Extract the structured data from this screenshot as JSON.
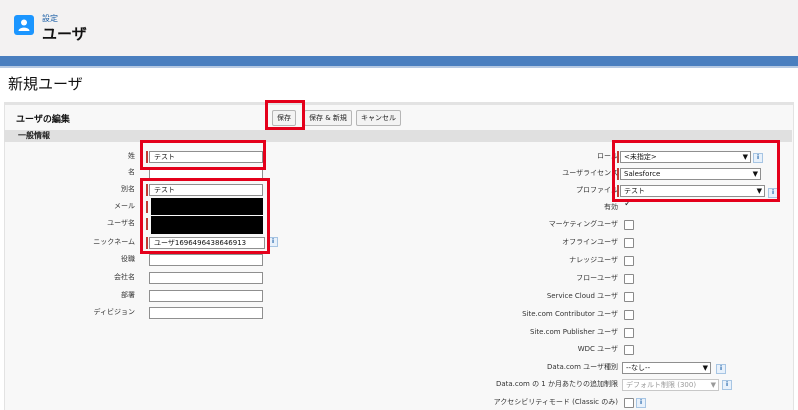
{
  "header": {
    "subtitle": "設定",
    "title": "ユーザ",
    "icon": "user-icon"
  },
  "page": {
    "title": "新規ユーザ"
  },
  "edit_section": {
    "title": "ユーザの編集"
  },
  "buttons": {
    "save": "保存",
    "save_new": "保存 & 新規",
    "cancel": "キャンセル"
  },
  "general_section": {
    "title": "一般情報"
  },
  "left_fields": {
    "last_name": {
      "label": "姓",
      "value": "テスト"
    },
    "first_name": {
      "label": "名",
      "value": ""
    },
    "alias": {
      "label": "別名",
      "value": "テスト"
    },
    "email": {
      "label": "メール"
    },
    "username": {
      "label": "ユーザ名"
    },
    "nickname": {
      "label": "ニックネーム",
      "value": "ユーザ1696496438646913"
    },
    "title": {
      "label": "役職",
      "value": ""
    },
    "company": {
      "label": "会社名",
      "value": ""
    },
    "department": {
      "label": "部署",
      "value": ""
    },
    "division": {
      "label": "ディビジョン",
      "value": ""
    }
  },
  "right_fields": {
    "role": {
      "label": "ロール",
      "value": "<未指定>"
    },
    "license": {
      "label": "ユーザライセンス",
      "value": "Salesforce"
    },
    "profile": {
      "label": "プロファイル",
      "value": "テスト"
    },
    "active": {
      "label": "有効",
      "checked": true,
      "mark": "✓"
    },
    "marketing": {
      "label": "マーケティングユーザ"
    },
    "offline": {
      "label": "オフラインユーザ"
    },
    "knowledge": {
      "label": "ナレッジユーザ"
    },
    "flow": {
      "label": "フローユーザ"
    },
    "service_cloud": {
      "label": "Service Cloud ユーザ"
    },
    "site_contributor": {
      "label": "Site.com Contributor ユーザ"
    },
    "site_publisher": {
      "label": "Site.com Publisher ユーザ"
    },
    "wdc": {
      "label": "WDC ユーザ"
    },
    "datacom_type": {
      "label": "Data.com ユーザ種別",
      "value": "--なし--"
    },
    "datacom_limit": {
      "label": "Data.com の 1 か月あたりの追加制限",
      "value": "デフォルト制限 (300)"
    },
    "accessibility": {
      "label": "アクセシビリティモード (Classic のみ)"
    }
  },
  "info_icon_glyph": "i",
  "colors": {
    "brand_blue": "#1b96ff",
    "highlight_red": "#e4001b",
    "required_red": "#c23934"
  }
}
